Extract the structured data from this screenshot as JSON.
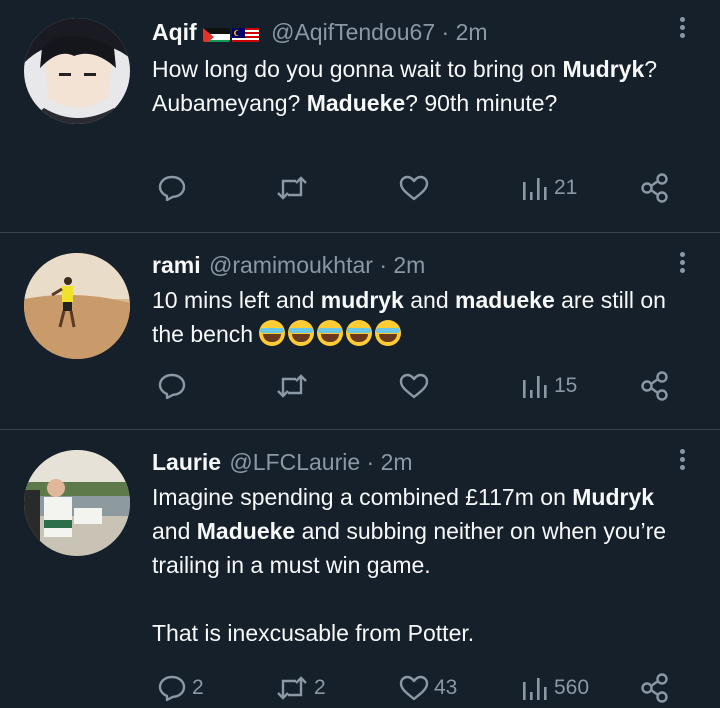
{
  "tweets": [
    {
      "name": "Aqif",
      "handle": "@AqifTendou67",
      "dot": "·",
      "time": "2m",
      "flags": [
        "palestine-flag",
        "malaysia-flag"
      ],
      "text_parts": [
        {
          "t": "How long do you gonna wait to bring on ",
          "b": false
        },
        {
          "t": "Mudryk",
          "b": true
        },
        {
          "t": "? Aubameyang? ",
          "b": false
        },
        {
          "t": "Madueke",
          "b": true
        },
        {
          "t": "? 90th minute?",
          "b": false
        }
      ],
      "views": "21"
    },
    {
      "name": "rami",
      "handle": "@ramimoukhtar",
      "dot": "·",
      "time": "2m",
      "text_parts": [
        {
          "t": "10 mins left and ",
          "b": false
        },
        {
          "t": "mudryk",
          "b": true
        },
        {
          "t": " and ",
          "b": false
        },
        {
          "t": "madueke",
          "b": true
        },
        {
          "t": " are still on the bench ",
          "b": false
        }
      ],
      "emoji": "😂😂😂😂😂",
      "views": "15"
    },
    {
      "name": "Laurie",
      "handle": "@LFCLaurie",
      "dot": "·",
      "time": "2m",
      "text_parts": [
        {
          "t": "Imagine spending a combined £117m on ",
          "b": false
        },
        {
          "t": "Mudryk",
          "b": true
        },
        {
          "t": " and ",
          "b": false
        },
        {
          "t": "Madueke",
          "b": true
        },
        {
          "t": " and subbing neither on when you’re trailing in a must win game.",
          "b": false
        }
      ],
      "text_para2": "That is inexcusable from Potter.",
      "replies": "2",
      "retweets": "2",
      "likes": "43",
      "views": "560"
    }
  ],
  "colors": {
    "background": "#15202b",
    "text": "#f7f9f9",
    "muted": "#8b98a5",
    "divider": "#38444d"
  }
}
